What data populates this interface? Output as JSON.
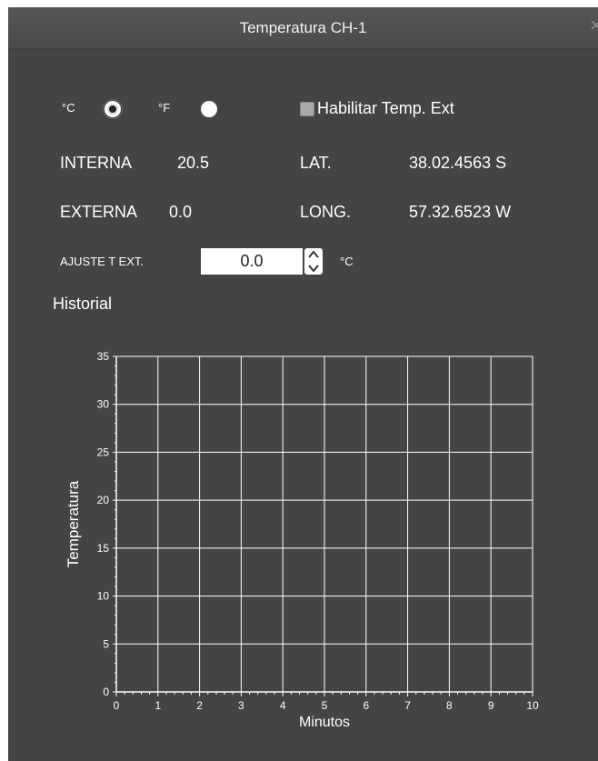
{
  "window": {
    "title": "Temperatura CH-1",
    "close_glyph": "×"
  },
  "units": {
    "celsius_label": "°C",
    "fahrenheit_label": "°F",
    "selected": "celsius",
    "enable_external_label": "Habilitar Temp. Ext",
    "enable_external_checked": false
  },
  "readings": {
    "internal_label": "INTERNA",
    "internal_value": "20.5",
    "external_label": "EXTERNA",
    "external_value": "0.0",
    "lat_label": "LAT.",
    "lat_value": "38.02.4563 S",
    "long_label": "LONG.",
    "long_value": "57.32.6523 W"
  },
  "adjust": {
    "label": "AJUSTE T EXT.",
    "value": "0.0",
    "unit": "°C"
  },
  "history": {
    "label": "Historial"
  },
  "chart_data": {
    "type": "line",
    "title": "",
    "xlabel": "Minutos",
    "ylabel": "Temperatura",
    "xlim": [
      0,
      10
    ],
    "ylim": [
      0,
      35
    ],
    "x_ticks": [
      0,
      1,
      2,
      3,
      4,
      5,
      6,
      7,
      8,
      9,
      10
    ],
    "y_ticks": [
      0,
      5,
      10,
      15,
      20,
      25,
      30,
      35
    ],
    "grid": true,
    "series": [],
    "colors": {
      "background": "#444444",
      "grid": "#ffffff",
      "axis": "#ffffff"
    }
  }
}
